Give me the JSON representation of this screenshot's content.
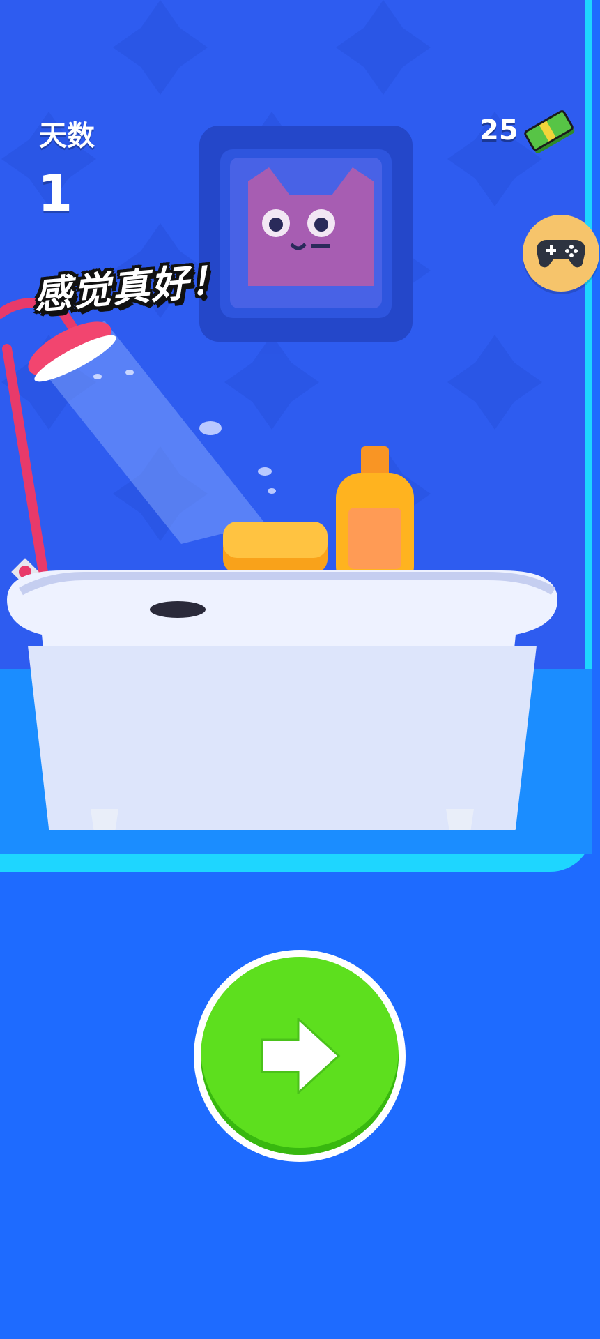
{
  "hud": {
    "day_label": "天数",
    "day_value": "1",
    "coins": "25"
  },
  "speech_bubble": "感觉真好！",
  "icons": {
    "cash": "cash-stack-icon",
    "gamepad": "gamepad-icon",
    "next": "arrow-right-icon"
  },
  "colors": {
    "background": "#1e6bff",
    "wall": "#2e5cf0",
    "frame_accent": "#1ed6ff",
    "next_button": "#5ddf1e",
    "gamepad_button": "#f6c46b",
    "shower_pink": "#e83a6a"
  }
}
